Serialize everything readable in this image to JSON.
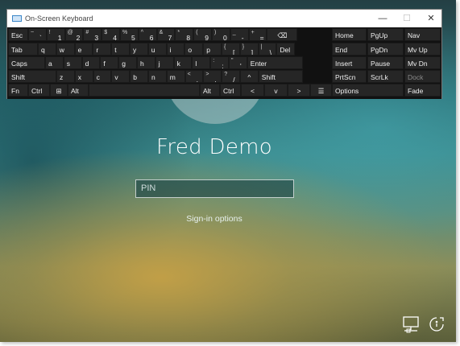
{
  "window": {
    "title": "On-Screen Keyboard",
    "minimize_glyph": "—",
    "maximize_glyph": "☐",
    "close_glyph": "✕"
  },
  "keyboard": {
    "row1": [
      {
        "label": "Esc"
      },
      {
        "alt": "~",
        "main": "`"
      },
      {
        "alt": "!",
        "main": "1"
      },
      {
        "alt": "@",
        "main": "2"
      },
      {
        "alt": "#",
        "main": "3"
      },
      {
        "alt": "$",
        "main": "4"
      },
      {
        "alt": "%",
        "main": "5"
      },
      {
        "alt": "^",
        "main": "6"
      },
      {
        "alt": "&",
        "main": "7"
      },
      {
        "alt": "*",
        "main": "8"
      },
      {
        "alt": "(",
        "main": "9"
      },
      {
        "alt": ")",
        "main": "0"
      },
      {
        "alt": "_",
        "main": "-"
      },
      {
        "alt": "+",
        "main": "="
      },
      {
        "label": "⌫"
      }
    ],
    "row2": [
      "Tab",
      "q",
      "w",
      "e",
      "r",
      "t",
      "y",
      "u",
      "i",
      "o",
      "p",
      "[",
      "]",
      "\\",
      "Del"
    ],
    "row2_alts": {
      "brace_open": "{",
      "brace_close": "}",
      "pipe": "|"
    },
    "row3": [
      "Caps",
      "a",
      "s",
      "d",
      "f",
      "g",
      "h",
      "j",
      "k",
      "l",
      ";",
      "'",
      "Enter"
    ],
    "row3_alts": {
      "colon": ":",
      "quote": "\""
    },
    "row4": [
      "Shift",
      "z",
      "x",
      "c",
      "v",
      "b",
      "n",
      "m",
      ",",
      ".",
      "/",
      "^",
      "Shift"
    ],
    "row4_alts": {
      "lt": "<",
      "gt": ">",
      "question": "?"
    },
    "row5": [
      "Fn",
      "Ctrl",
      "⊞",
      "Alt",
      "",
      "Alt",
      "Ctrl",
      "<",
      "v",
      ">",
      "☰"
    ],
    "nav_keys": [
      [
        "Home",
        "PgUp",
        "Nav"
      ],
      [
        "End",
        "PgDn",
        "Mv Up"
      ],
      [
        "Insert",
        "Pause",
        "Mv Dn"
      ],
      [
        "PrtScn",
        "ScrLk",
        "Dock"
      ],
      [
        "Options",
        "Fade"
      ]
    ]
  },
  "login": {
    "user_name": "Fred Demo",
    "pin_placeholder": "PIN",
    "signin_options": "Sign-in options"
  },
  "icons": {
    "network": "network-icon",
    "ease_of_access": "ease-of-access-icon"
  },
  "colors": {
    "keyboard_bg": "#111111",
    "key_bg": "#262626",
    "key_text": "#f0f0f0",
    "login_text": "#ffffff"
  }
}
